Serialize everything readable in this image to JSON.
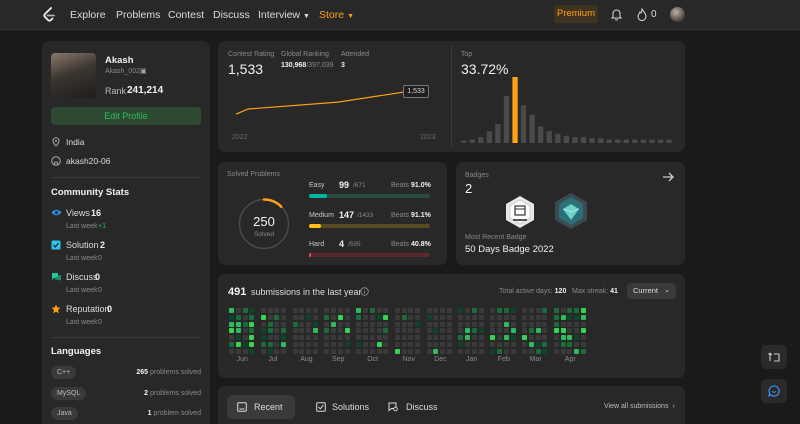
{
  "nav": {
    "links": [
      "Explore",
      "Problems",
      "Contest",
      "Discuss",
      "Interview",
      "Store"
    ],
    "premium": "Premium",
    "flame_count": "0"
  },
  "profile": {
    "name": "Akash",
    "username": "Akash_002",
    "rank_label": "Rank",
    "rank": "241,214",
    "edit_label": "Edit Profile",
    "location": "India",
    "github": "akash20-06"
  },
  "community": {
    "title": "Community Stats",
    "items": [
      {
        "label": "Views",
        "value": "16",
        "sub": "Last week",
        "delta": "+1",
        "color": "#2196f3"
      },
      {
        "label": "Solution",
        "value": "2",
        "sub": "Last week",
        "delta": "0",
        "color": "#2ec4f0"
      },
      {
        "label": "Discuss",
        "value": "0",
        "sub": "Last week",
        "delta": "0",
        "color": "#20c997"
      },
      {
        "label": "Reputation",
        "value": "0",
        "sub": "Last week",
        "delta": "0",
        "color": "#ffa116"
      }
    ]
  },
  "languages": {
    "title": "Languages",
    "items": [
      {
        "name": "C++",
        "count": "265",
        "suffix": "problems solved"
      },
      {
        "name": "MySQL",
        "count": "2",
        "suffix": "problems solved"
      },
      {
        "name": "Java",
        "count": "1",
        "suffix": "problem solved"
      }
    ]
  },
  "contest": {
    "rating_label": "Contest Rating",
    "rating": "1,533",
    "global_label": "Global Ranking",
    "global_rank": "130,968",
    "global_total": "/397,039",
    "attended_label": "Attended",
    "attended": "3",
    "tooltip": "1,533",
    "top_label": "Top",
    "top_value": "33.72%"
  },
  "chart_data": [
    {
      "type": "line",
      "x": [
        "2022",
        "2023"
      ],
      "values": [
        1460,
        1475,
        1495,
        1533
      ],
      "xlabel": "",
      "ylabel": ""
    },
    {
      "type": "bar",
      "values": [
        2,
        3,
        5,
        10,
        16,
        40,
        56,
        32,
        24,
        14,
        10,
        8,
        6,
        5,
        5,
        4,
        4,
        3,
        3,
        3,
        3,
        3,
        3,
        3,
        3
      ],
      "highlight_index": 6,
      "xlabel": "",
      "ylabel": ""
    }
  ],
  "solved": {
    "title": "Solved Problems",
    "total": "250",
    "total_label": "Solved",
    "rows": [
      {
        "label": "Easy",
        "count": "99",
        "total": "/671",
        "beats_label": "Beats",
        "beats": "91.0%",
        "fraction": 0.1475,
        "color": "#00b8a3",
        "track": "#2a4a44"
      },
      {
        "label": "Medium",
        "count": "147",
        "total": "/1433",
        "beats_label": "Beats",
        "beats": "91.1%",
        "fraction": 0.1026,
        "color": "#ffc01e",
        "track": "#5a4a24"
      },
      {
        "label": "Hard",
        "count": "4",
        "total": "/595",
        "beats_label": "Beats",
        "beats": "40.8%",
        "fraction": 0.0067,
        "color": "#ef4743",
        "track": "#5a2a2a"
      }
    ]
  },
  "badges": {
    "title": "Badges",
    "count": "2",
    "recent_label": "Most Recent Badge",
    "recent_name": "50 Days Badge 2022"
  },
  "submissions": {
    "count": "491",
    "text": "submissions in the last year",
    "active_label": "Total active days:",
    "active_days": "120",
    "streak_label": "Max streak:",
    "max_streak": "41",
    "dropdown": "Current",
    "months": [
      "Jun",
      "Jul",
      "Aug",
      "Sep",
      "Oct",
      "Nov",
      "Dec",
      "Jan",
      "Feb",
      "Mar",
      "Apr"
    ]
  },
  "tabs": {
    "recent": "Recent AC",
    "solutions": "Solutions",
    "discuss": "Discuss",
    "view_all": "View all submissions"
  }
}
